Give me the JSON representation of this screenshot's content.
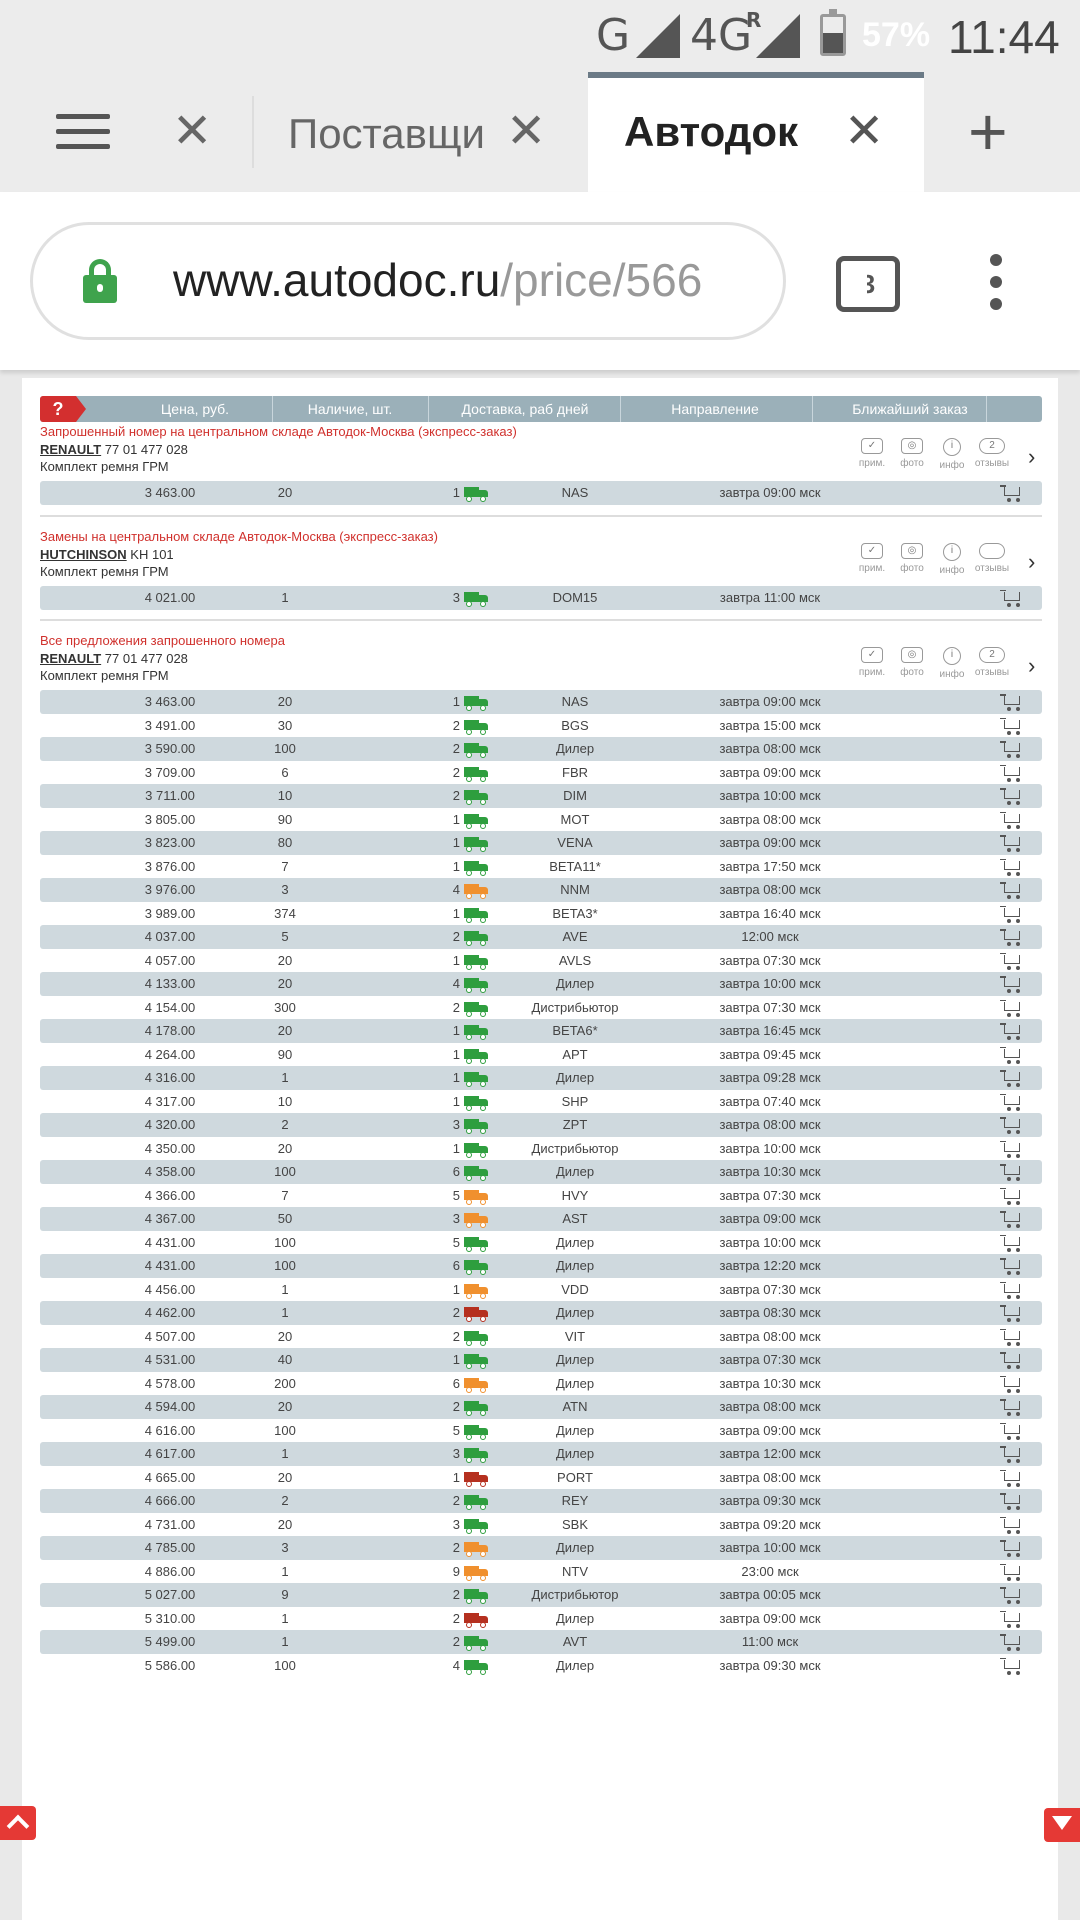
{
  "status_bar": {
    "network": "G",
    "network2": "4G",
    "roaming": "R",
    "battery": "57%",
    "time": "11:44"
  },
  "browser": {
    "tabs": [
      {
        "title": "Поставщи",
        "active": false
      },
      {
        "title": "Автодок",
        "active": true
      }
    ],
    "url_domain": "www.autodoc.ru",
    "url_path": "/price/566",
    "tab_count": "3"
  },
  "table_header": {
    "help": "?",
    "columns": [
      "Цена, руб.",
      "Наличие, шт.",
      "Доставка, раб дней",
      "Направление",
      "Ближайший заказ"
    ]
  },
  "icon_labels": [
    "прим.",
    "фото",
    "инфо",
    "отзывы"
  ],
  "colors": {
    "green": "#2e9e3e",
    "orange": "#f0902e",
    "red": "#b5301f"
  },
  "sections": [
    {
      "title": "Запрошенный номер на центральном складе Автодок-Москва (экспресс-заказ)",
      "brand": "RENAULT",
      "number": "77 01 477 028",
      "desc": "Комплект ремня ГРМ",
      "reviews": "2",
      "rows": [
        [
          "3 463.00",
          "20",
          "1",
          "green",
          "NAS",
          "завтра 09:00 мск"
        ]
      ]
    },
    {
      "title": "Замены на центральном складе Автодок-Москва (экспресс-заказ)",
      "brand": "HUTCHINSON",
      "number": "KH 101",
      "desc": "Комплект ремня ГРМ",
      "reviews": "",
      "rows": [
        [
          "4 021.00",
          "1",
          "3",
          "green",
          "DOM15",
          "завтра 11:00 мск"
        ]
      ]
    },
    {
      "title": "Все предложения запрошенного номера",
      "brand": "RENAULT",
      "number": "77 01 477 028",
      "desc": "Комплект ремня ГРМ",
      "reviews": "2",
      "rows": [
        [
          "3 463.00",
          "20",
          "1",
          "green",
          "NAS",
          "завтра 09:00 мск"
        ],
        [
          "3 491.00",
          "30",
          "2",
          "green",
          "BGS",
          "завтра 15:00 мск"
        ],
        [
          "3 590.00",
          "100",
          "2",
          "green",
          "Дилер",
          "завтра 08:00 мск"
        ],
        [
          "3 709.00",
          "6",
          "2",
          "green",
          "FBR",
          "завтра 09:00 мск"
        ],
        [
          "3 711.00",
          "10",
          "2",
          "green",
          "DIM",
          "завтра 10:00 мск"
        ],
        [
          "3 805.00",
          "90",
          "1",
          "green",
          "MOT",
          "завтра 08:00 мск"
        ],
        [
          "3 823.00",
          "80",
          "1",
          "green",
          "VENA",
          "завтра 09:00 мск"
        ],
        [
          "3 876.00",
          "7",
          "1",
          "green",
          "BETA11*",
          "завтра 17:50 мск"
        ],
        [
          "3 976.00",
          "3",
          "4",
          "orange",
          "NNM",
          "завтра 08:00 мск"
        ],
        [
          "3 989.00",
          "374",
          "1",
          "green",
          "BETA3*",
          "завтра 16:40 мск"
        ],
        [
          "4 037.00",
          "5",
          "2",
          "green",
          "AVE",
          "12:00 мск"
        ],
        [
          "4 057.00",
          "20",
          "1",
          "green",
          "AVLS",
          "завтра 07:30 мск"
        ],
        [
          "4 133.00",
          "20",
          "4",
          "green",
          "Дилер",
          "завтра 10:00 мск"
        ],
        [
          "4 154.00",
          "300",
          "2",
          "green",
          "Дистрибьютор",
          "завтра 07:30 мск"
        ],
        [
          "4 178.00",
          "20",
          "1",
          "green",
          "BETA6*",
          "завтра 16:45 мск"
        ],
        [
          "4 264.00",
          "90",
          "1",
          "green",
          "APT",
          "завтра 09:45 мск"
        ],
        [
          "4 316.00",
          "1",
          "1",
          "green",
          "Дилер",
          "завтра 09:28 мск"
        ],
        [
          "4 317.00",
          "10",
          "1",
          "green",
          "SHP",
          "завтра 07:40 мск"
        ],
        [
          "4 320.00",
          "2",
          "3",
          "green",
          "ZPT",
          "завтра 08:00 мск"
        ],
        [
          "4 350.00",
          "20",
          "1",
          "green",
          "Дистрибьютор",
          "завтра 10:00 мск"
        ],
        [
          "4 358.00",
          "100",
          "6",
          "green",
          "Дилер",
          "завтра 10:30 мск"
        ],
        [
          "4 366.00",
          "7",
          "5",
          "orange",
          "HVY",
          "завтра 07:30 мск"
        ],
        [
          "4 367.00",
          "50",
          "3",
          "orange",
          "AST",
          "завтра 09:00 мск"
        ],
        [
          "4 431.00",
          "100",
          "5",
          "green",
          "Дилер",
          "завтра 10:00 мск"
        ],
        [
          "4 431.00",
          "100",
          "6",
          "green",
          "Дилер",
          "завтра 12:20 мск"
        ],
        [
          "4 456.00",
          "1",
          "1",
          "orange",
          "VDD",
          "завтра 07:30 мск"
        ],
        [
          "4 462.00",
          "1",
          "2",
          "red",
          "Дилер",
          "завтра 08:30 мск"
        ],
        [
          "4 507.00",
          "20",
          "2",
          "green",
          "VIT",
          "завтра 08:00 мск"
        ],
        [
          "4 531.00",
          "40",
          "1",
          "green",
          "Дилер",
          "завтра 07:30 мск"
        ],
        [
          "4 578.00",
          "200",
          "6",
          "orange",
          "Дилер",
          "завтра 10:30 мск"
        ],
        [
          "4 594.00",
          "20",
          "2",
          "green",
          "ATN",
          "завтра 08:00 мск"
        ],
        [
          "4 616.00",
          "100",
          "5",
          "green",
          "Дилер",
          "завтра 09:00 мск"
        ],
        [
          "4 617.00",
          "1",
          "3",
          "green",
          "Дилер",
          "завтра 12:00 мск"
        ],
        [
          "4 665.00",
          "20",
          "1",
          "red",
          "PORT",
          "завтра 08:00 мск"
        ],
        [
          "4 666.00",
          "2",
          "2",
          "green",
          "REY",
          "завтра 09:30 мск"
        ],
        [
          "4 731.00",
          "20",
          "3",
          "green",
          "SBK",
          "завтра 09:20 мск"
        ],
        [
          "4 785.00",
          "3",
          "2",
          "orange",
          "Дилер",
          "завтра 10:00 мск"
        ],
        [
          "4 886.00",
          "1",
          "9",
          "orange",
          "NTV",
          "23:00 мск"
        ],
        [
          "5 027.00",
          "9",
          "2",
          "green",
          "Дистрибьютор",
          "завтра 00:05 мск"
        ],
        [
          "5 310.00",
          "1",
          "2",
          "red",
          "Дилер",
          "завтра 09:00 мск"
        ],
        [
          "5 499.00",
          "1",
          "2",
          "green",
          "AVT",
          "11:00 мск"
        ],
        [
          "5 586.00",
          "100",
          "4",
          "green",
          "Дилер",
          "завтра 09:30 мск"
        ]
      ]
    }
  ]
}
